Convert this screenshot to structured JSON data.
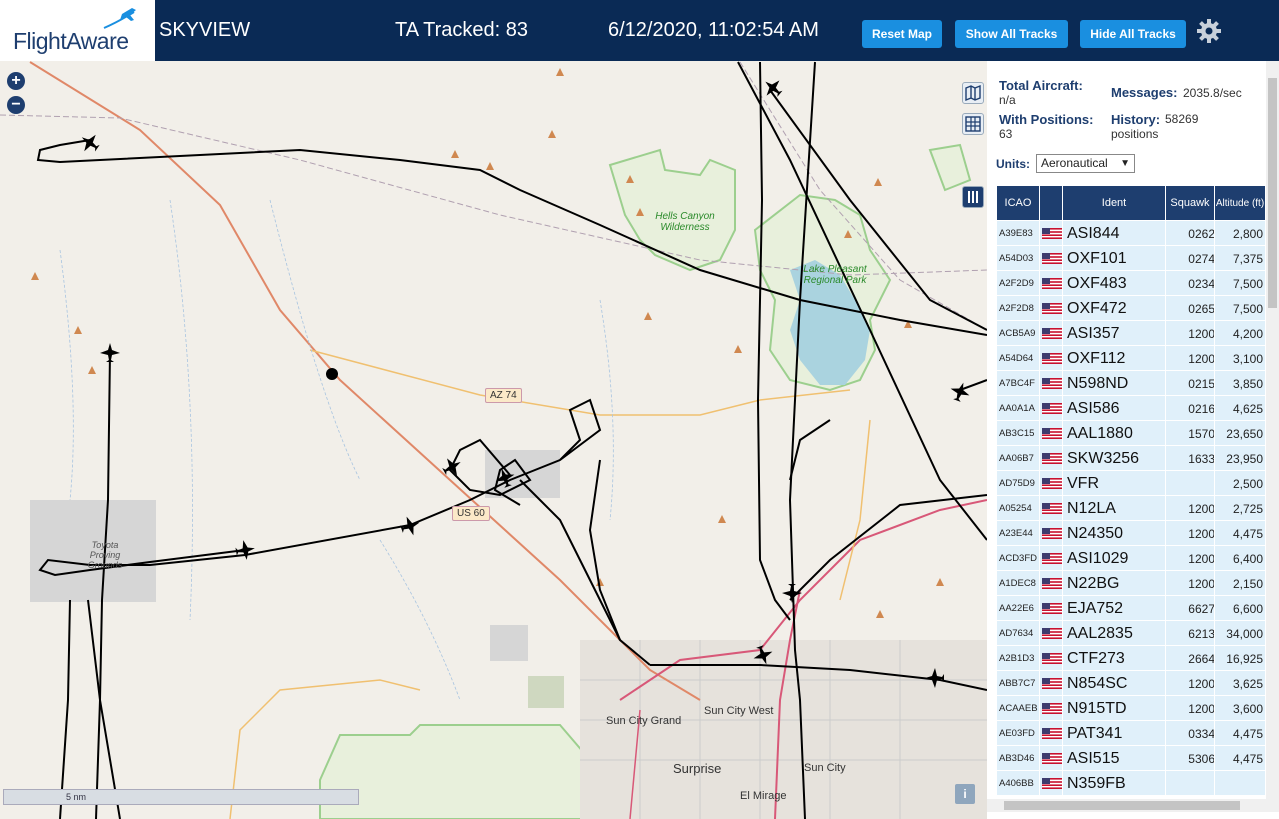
{
  "header": {
    "logo_text": "FlightAware",
    "app_name": "SKYVIEW",
    "tracked": "TA Tracked: 83",
    "datetime": "6/12/2020, 11:02:54 AM",
    "reset_map": "Reset Map",
    "show_all_tracks": "Show All Tracks",
    "hide_all_tracks": "Hide All Tracks"
  },
  "map": {
    "scale_label": "5 nm",
    "labels": {
      "hells_canyon": "Hells Canyon Wilderness",
      "lake_pleasant": "Lake Pleasant Regional Park",
      "toyota": "Toyota Proving Grounds",
      "az74": "AZ 74",
      "us60": "US 60",
      "sun_city_grand": "Sun City Grand",
      "sun_city_west": "Sun City West",
      "surprise": "Surprise",
      "sun_city": "Sun City",
      "el_mirage": "El Mirage"
    }
  },
  "stats": {
    "total_aircraft_label": "Total Aircraft:",
    "total_aircraft_value": "n/a",
    "with_positions_label": "With Positions:",
    "with_positions_value": "63",
    "messages_label": "Messages:",
    "messages_value": "2035.8/sec",
    "history_label": "History:",
    "history_value": "58269 positions"
  },
  "units": {
    "label": "Units:",
    "selected": "Aeronautical"
  },
  "table": {
    "headers": {
      "icao": "ICAO",
      "ident": "Ident",
      "squawk": "Squawk",
      "altitude": "Altitude (ft)"
    },
    "rows": [
      {
        "icao": "A39E83",
        "ident": "ASI844",
        "squawk": "0262",
        "alt": "2,800"
      },
      {
        "icao": "A54D03",
        "ident": "OXF101",
        "squawk": "0274",
        "alt": "7,375"
      },
      {
        "icao": "A2F2D9",
        "ident": "OXF483",
        "squawk": "0234",
        "alt": "7,500"
      },
      {
        "icao": "A2F2D8",
        "ident": "OXF472",
        "squawk": "0265",
        "alt": "7,500"
      },
      {
        "icao": "ACB5A9",
        "ident": "ASI357",
        "squawk": "1200",
        "alt": "4,200"
      },
      {
        "icao": "A54D64",
        "ident": "OXF112",
        "squawk": "1200",
        "alt": "3,100"
      },
      {
        "icao": "A7BC4F",
        "ident": "N598ND",
        "squawk": "0215",
        "alt": "3,850"
      },
      {
        "icao": "AA0A1A",
        "ident": "ASI586",
        "squawk": "0216",
        "alt": "4,625"
      },
      {
        "icao": "AB3C15",
        "ident": "AAL1880",
        "squawk": "1570",
        "alt": "23,650"
      },
      {
        "icao": "AA06B7",
        "ident": "SKW3256",
        "squawk": "1633",
        "alt": "23,950"
      },
      {
        "icao": "AD75D9",
        "ident": "VFR",
        "squawk": "",
        "alt": "2,500"
      },
      {
        "icao": "A05254",
        "ident": "N12LA",
        "squawk": "1200",
        "alt": "2,725"
      },
      {
        "icao": "A23E44",
        "ident": "N24350",
        "squawk": "1200",
        "alt": "4,475"
      },
      {
        "icao": "ACD3FD",
        "ident": "ASI1029",
        "squawk": "1200",
        "alt": "6,400"
      },
      {
        "icao": "A1DEC8",
        "ident": "N22BG",
        "squawk": "1200",
        "alt": "2,150"
      },
      {
        "icao": "AA22E6",
        "ident": "EJA752",
        "squawk": "6627",
        "alt": "6,600"
      },
      {
        "icao": "AD7634",
        "ident": "AAL2835",
        "squawk": "6213",
        "alt": "34,000"
      },
      {
        "icao": "A2B1D3",
        "ident": "CTF273",
        "squawk": "2664",
        "alt": "16,925"
      },
      {
        "icao": "ABB7C7",
        "ident": "N854SC",
        "squawk": "1200",
        "alt": "3,625"
      },
      {
        "icao": "ACAAEB",
        "ident": "N915TD",
        "squawk": "1200",
        "alt": "3,600"
      },
      {
        "icao": "AE03FD",
        "ident": "PAT341",
        "squawk": "0334",
        "alt": "4,475"
      },
      {
        "icao": "AB3D46",
        "ident": "ASI515",
        "squawk": "5306",
        "alt": "4,475"
      },
      {
        "icao": "A406BB",
        "ident": "N359FB",
        "squawk": "",
        "alt": ""
      }
    ]
  }
}
